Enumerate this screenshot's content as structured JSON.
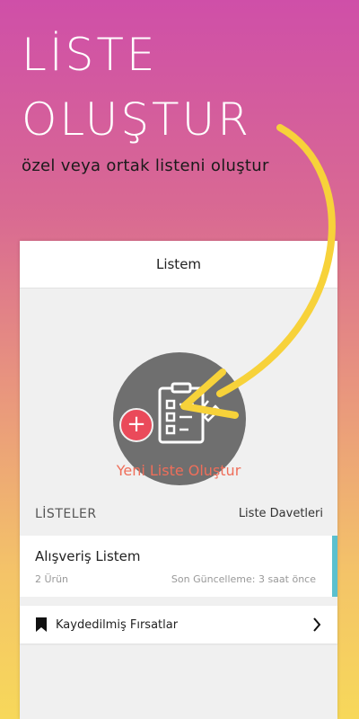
{
  "promo": {
    "title_line1": "LİSTE",
    "title_line2": "OLUŞTUR",
    "subtitle": "özel veya ortak listeni oluştur"
  },
  "app": {
    "nav_title": "Listem",
    "create_label": "Yeni Liste Oluştur",
    "section_left": "LİSTELER",
    "section_right": "Liste Davetleri",
    "list_item": {
      "name": "Alışveriş Listem",
      "count": "2 Ürün",
      "updated": "Son Güncelleme: 3 saat önce"
    },
    "saved_label": "Kaydedilmiş Fırsatlar"
  },
  "icons": {
    "plus": "plus-icon",
    "clipboard": "clipboard-checklist-icon",
    "bookmark": "bookmark-icon",
    "chevron": "chevron-right-icon",
    "arrow": "curved-arrow-icon"
  },
  "colors": {
    "accent_red": "#ea4a5a",
    "create_text": "#ef6e5a",
    "list_accent": "#5bc0ce",
    "arrow_yellow": "#f7d23a"
  }
}
